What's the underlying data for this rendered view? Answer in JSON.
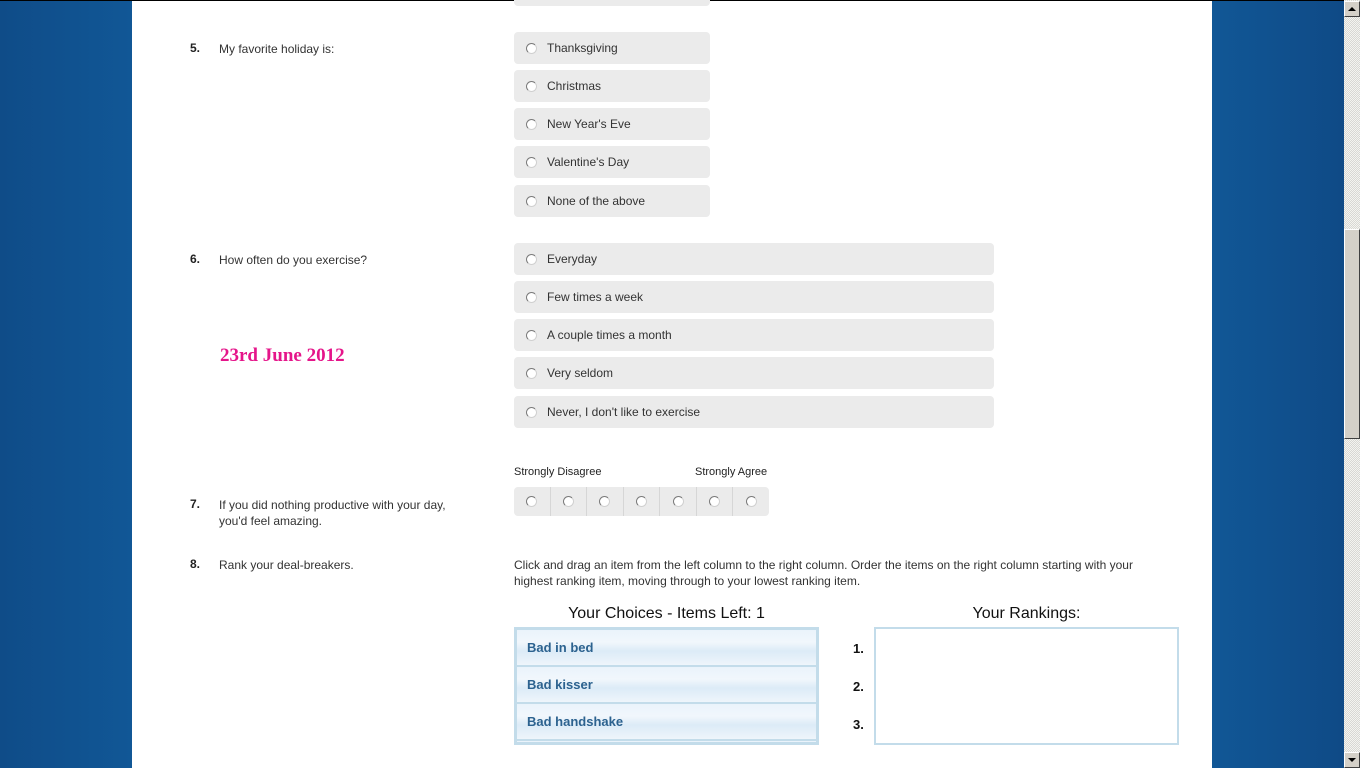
{
  "questions": [
    {
      "number": "5.",
      "text": "My favorite holiday is:",
      "options": [
        "Thanksgiving",
        "Christmas",
        "New Year's Eve",
        "Valentine's Day",
        "None of the above"
      ]
    },
    {
      "number": "6.",
      "text": "How often do you exercise?",
      "options": [
        "Everyday",
        "Few times a week",
        "A couple times a month",
        "Very seldom",
        "Never, I don't like to exercise"
      ]
    },
    {
      "number": "7.",
      "text": "If you did nothing productive with your day, you'd feel amazing.",
      "scale_left_label": "Strongly Disagree",
      "scale_right_label": "Strongly Agree",
      "scale_points": 7
    },
    {
      "number": "8.",
      "text": "Rank your deal-breakers.",
      "instructions": "Click and drag an item from the left column to the right column. Order the items on the right column starting with your highest ranking item, moving through to your lowest ranking item.",
      "choices_title": "Your Choices - Items Left: 1",
      "rankings_title": "Your Rankings:",
      "choices": [
        "Bad in bed",
        "Bad kisser",
        "Bad handshake"
      ],
      "rank_numbers": [
        "1.",
        "2.",
        "3."
      ]
    }
  ],
  "date_stamp": "23rd June 2012",
  "colors": {
    "background_blue": "#0f4c8a",
    "option_bg": "#ebebeb",
    "date_stamp": "#e5158a",
    "choice_text": "#2c628f",
    "choice_border": "#c3dcea"
  },
  "scrollbar": {
    "position_fraction": 0.31
  }
}
